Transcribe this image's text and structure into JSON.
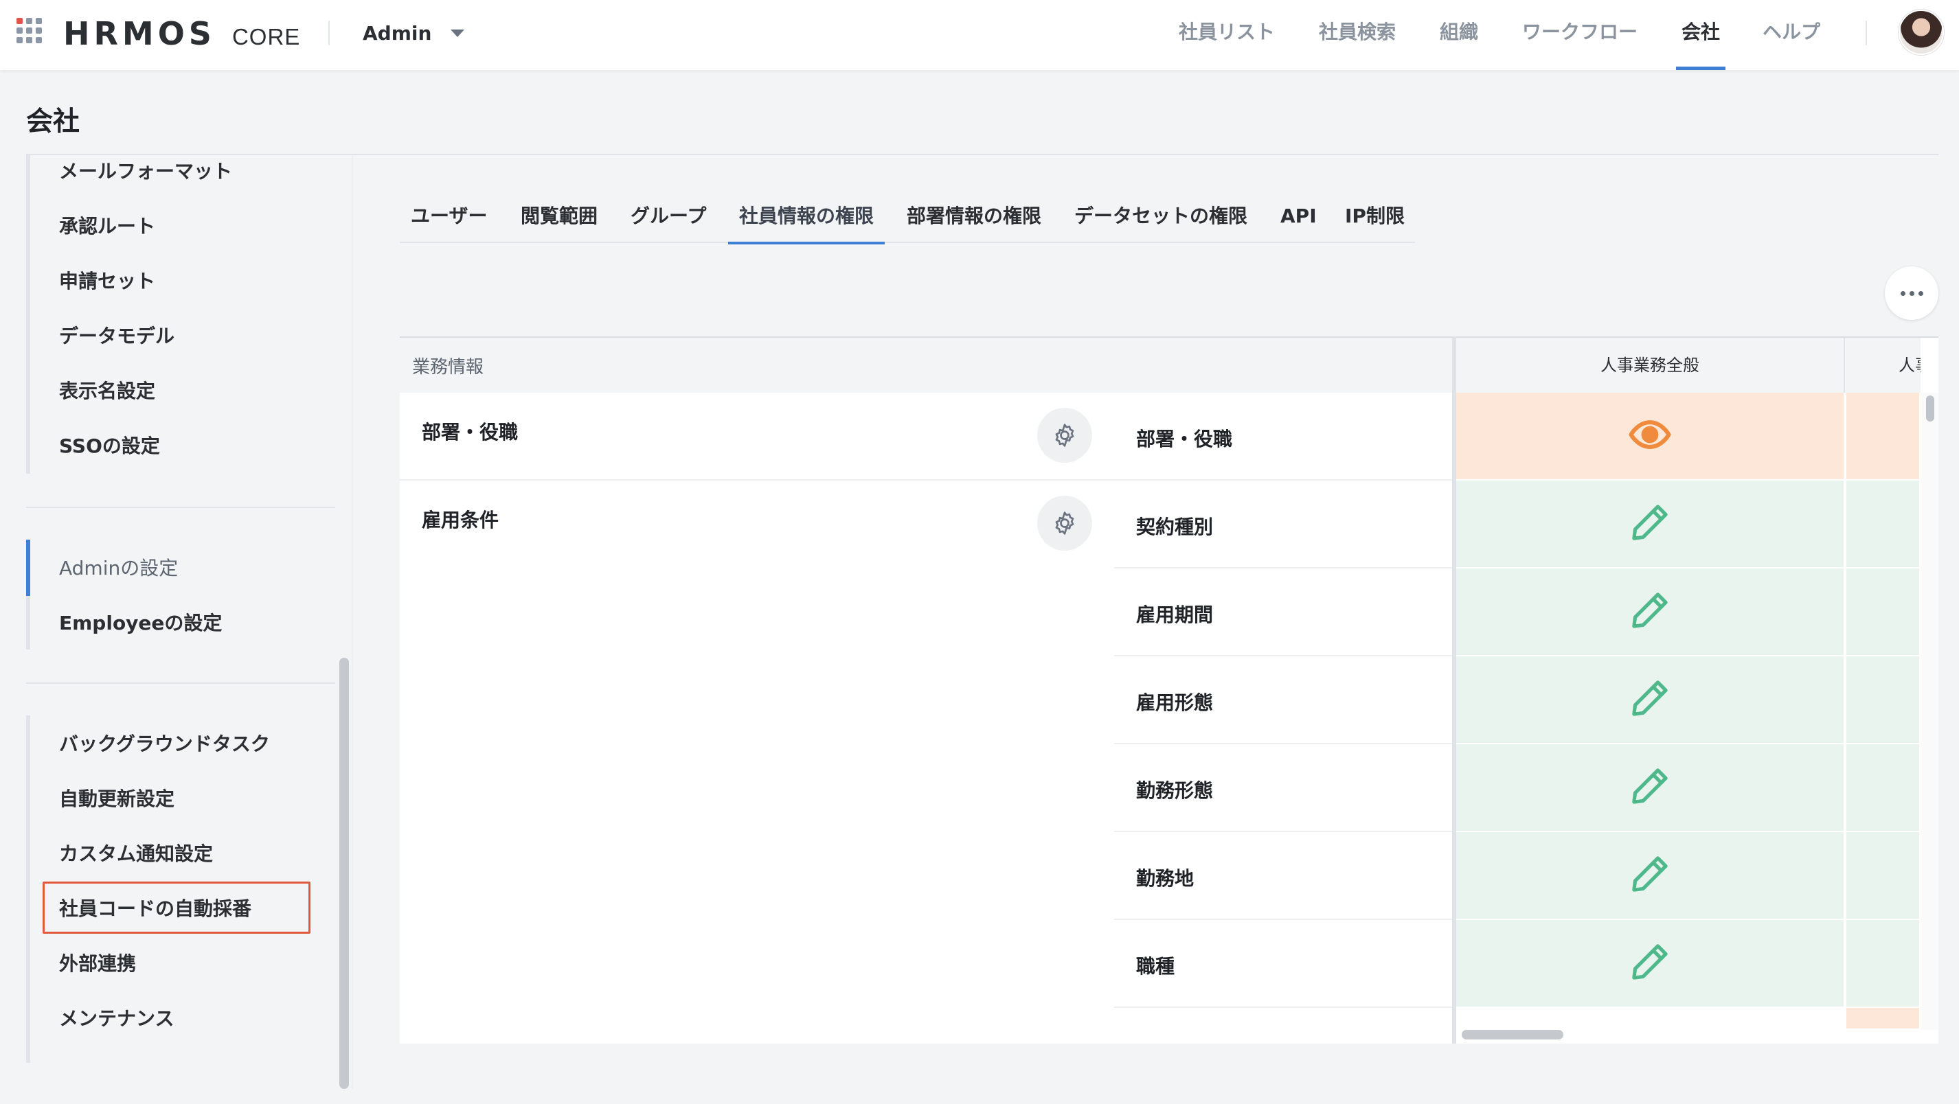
{
  "header": {
    "logo": "HRMOS",
    "product": "CORE",
    "role": "Admin",
    "nav": [
      {
        "label": "社員リスト",
        "active": false
      },
      {
        "label": "社員検索",
        "active": false
      },
      {
        "label": "組織",
        "active": false
      },
      {
        "label": "ワークフロー",
        "active": false
      },
      {
        "label": "会社",
        "active": true
      },
      {
        "label": "ヘルプ",
        "active": false
      }
    ]
  },
  "page": {
    "title": "会社"
  },
  "sidebar": {
    "group1": [
      "メールフォーマット",
      "承認ルート",
      "申請セット",
      "データモデル",
      "表示名設定",
      "SSOの設定"
    ],
    "group2": [
      {
        "label": "Adminの設定",
        "active": true
      },
      {
        "label": "Employeeの設定",
        "active": false
      }
    ],
    "group3": [
      "バックグラウンドタスク",
      "自動更新設定",
      "カスタム通知設定",
      "社員コードの自動採番",
      "外部連携",
      "メンテナンス"
    ],
    "highlighted_item": "社員コードの自動採番"
  },
  "tabs": [
    {
      "label": "ユーザー",
      "active": false
    },
    {
      "label": "閲覧範囲",
      "active": false
    },
    {
      "label": "グループ",
      "active": false
    },
    {
      "label": "社員情報の権限",
      "active": true
    },
    {
      "label": "部署情報の権限",
      "active": false
    },
    {
      "label": "データセットの権限",
      "active": false
    },
    {
      "label": "API",
      "active": false
    },
    {
      "label": "IP制限",
      "active": false
    }
  ],
  "table": {
    "section_label": "業務情報",
    "categories": [
      "部署・役職",
      "雇用条件"
    ],
    "fields": [
      "部署・役職",
      "契約種別",
      "雇用期間",
      "雇用形態",
      "勤務形態",
      "勤務地",
      "職種"
    ],
    "columns": [
      "人事業務全般",
      "人事"
    ],
    "permissions": [
      "view",
      "edit",
      "edit",
      "edit",
      "edit",
      "edit",
      "edit"
    ],
    "colors": {
      "view_bg": "#fde7d9",
      "view_icon": "#f08a3c",
      "edit_bg": "#eaf4ef",
      "edit_icon": "#4fb88a"
    },
    "icons": {
      "view": "eye-icon",
      "edit": "pencil-icon",
      "settings": "gear-icon"
    }
  }
}
